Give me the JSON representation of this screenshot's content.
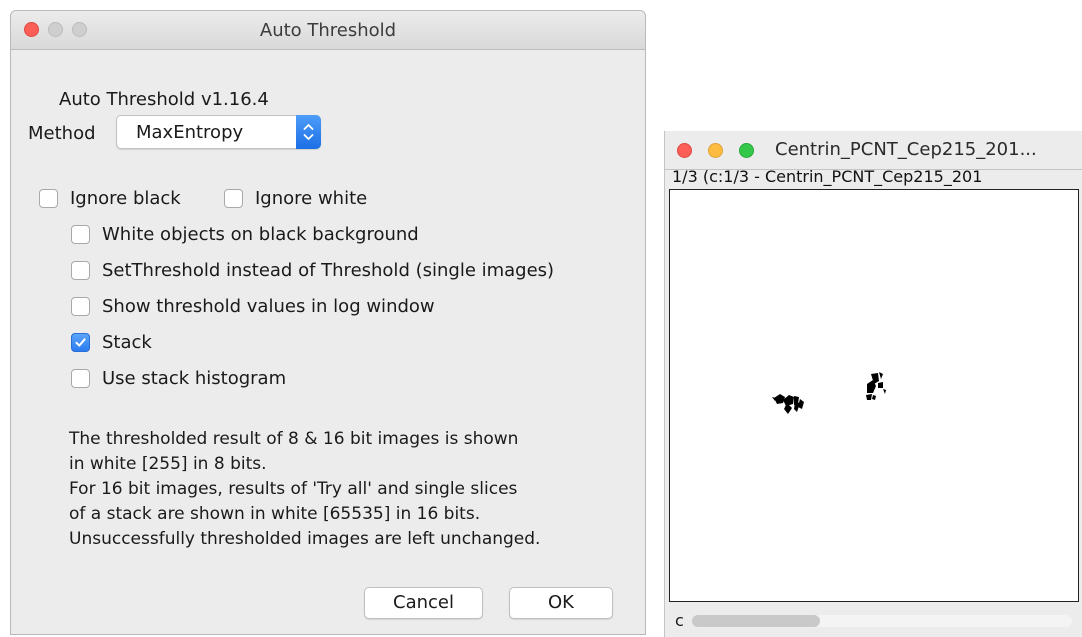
{
  "dialog": {
    "title": "Auto Threshold",
    "version": "Auto Threshold v1.16.4",
    "method_label": "Method",
    "method_value": "MaxEntropy",
    "checkboxes": {
      "ignore_black": {
        "label": "Ignore black",
        "checked": false
      },
      "ignore_white": {
        "label": "Ignore white",
        "checked": false
      },
      "white_objects": {
        "label": "White objects on black background",
        "checked": false
      },
      "set_threshold": {
        "label": "SetThreshold instead of Threshold (single images)",
        "checked": false
      },
      "show_values": {
        "label": "Show threshold values in log window",
        "checked": false
      },
      "stack": {
        "label": "Stack",
        "checked": true
      },
      "stack_histogram": {
        "label": "Use stack histogram",
        "checked": false
      }
    },
    "info_lines": [
      "The thresholded result of 8 & 16 bit images is shown",
      "in white [255] in 8 bits.",
      "For 16 bit images, results of 'Try all' and single slices",
      "of a stack are shown in white [65535] in 16 bits.",
      "Unsuccessfully thresholded images are left unchanged."
    ],
    "cancel_label": "Cancel",
    "ok_label": "OK"
  },
  "image_window": {
    "title": "Centrin_PCNT_Cep215_201...",
    "subtitle": "1/3 (c:1/3 - Centrin_PCNT_Cep215_201",
    "slider_label": "c",
    "slider_position": 0.0
  },
  "colors": {
    "close_light": "#fc5f57",
    "minimize_light": "#fdbc40",
    "zoom_light": "#34c84a",
    "accent_blue": "#2a7bf0"
  }
}
